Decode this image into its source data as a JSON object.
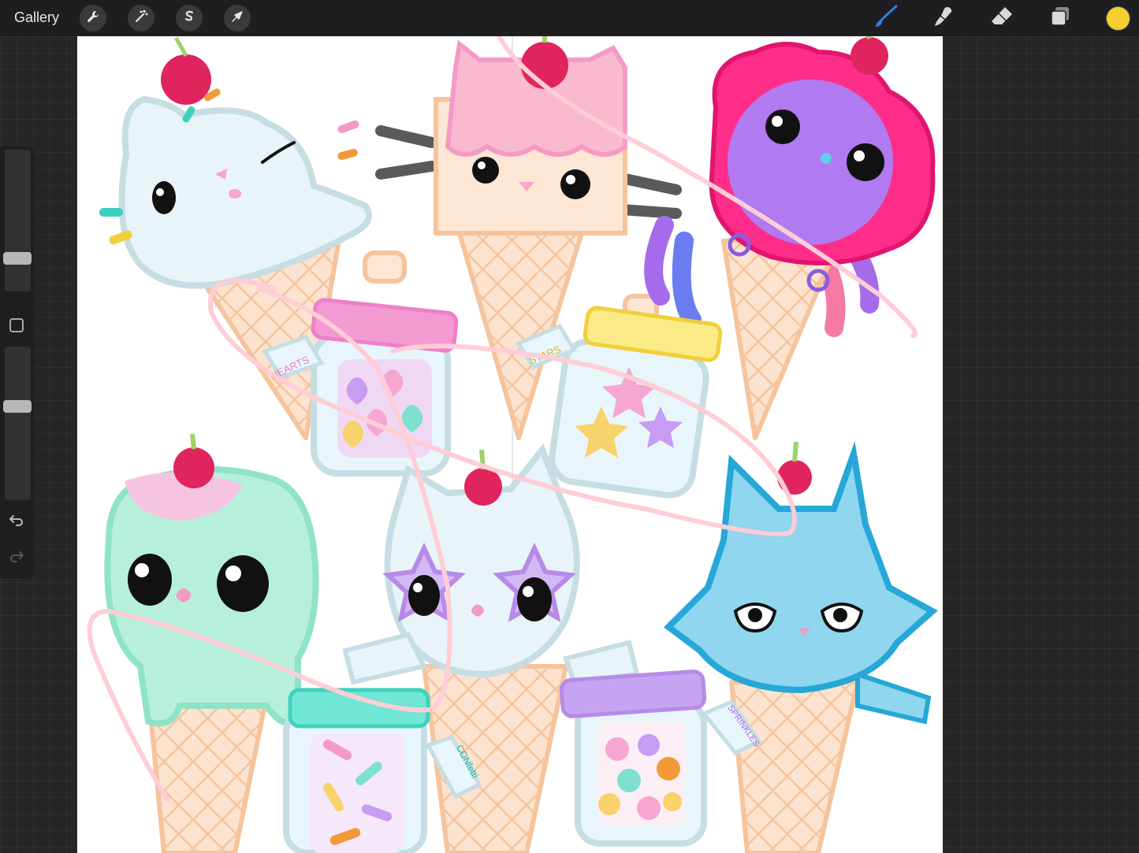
{
  "topbar": {
    "gallery_label": "Gallery",
    "left_tools": [
      "wrench-icon",
      "magic-wand-icon",
      "selection-icon",
      "transform-arrow-icon"
    ],
    "right_tools": [
      "brush-icon",
      "smudge-icon",
      "eraser-icon",
      "layers-icon"
    ],
    "active_tool": "brush-icon",
    "current_color": "#f5cf2f",
    "accent_color": "#2f7fe0"
  },
  "sidebar": {
    "brush_size_level": 0.21,
    "opacity_level": 0.62,
    "undo_icon": "undo-icon",
    "redo_icon": "redo-icon"
  },
  "canvas": {
    "jar_labels": {
      "hearts": "HEARTS",
      "stars": "STARS",
      "confetti": "CONfetti",
      "sprinkles": "SPRINKLES"
    }
  }
}
